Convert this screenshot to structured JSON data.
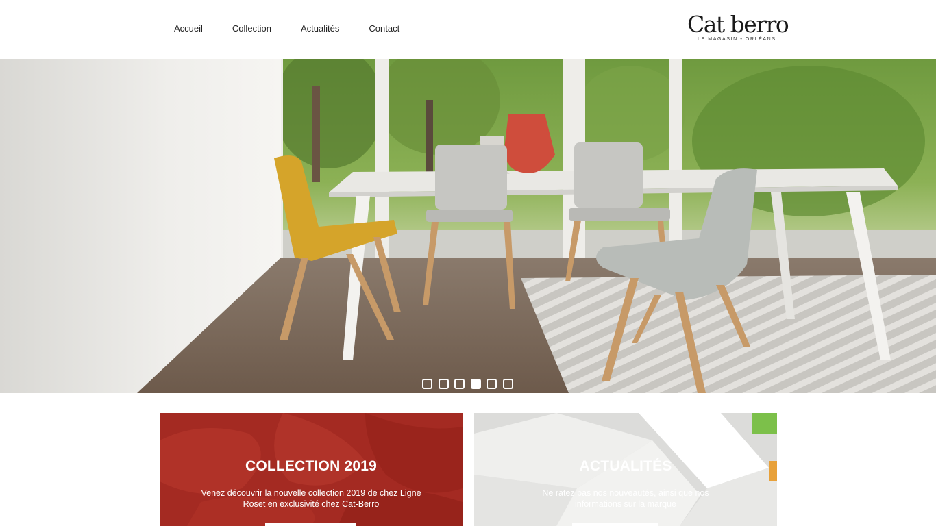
{
  "header": {
    "nav": [
      "Accueil",
      "Collection",
      "Actualités",
      "Contact"
    ],
    "logo": {
      "main": "Cat berro",
      "sub": "LE MAGASIN • ORLÉANS"
    }
  },
  "hero": {
    "slides_count": 6,
    "active_slide": 4
  },
  "cards": [
    {
      "title": "COLLECTION 2019",
      "text": "Venez découvrir la nouvelle collection 2019 de chez Ligne Roset en exclusivité chez Cat-Berro",
      "color": "#a42a22"
    },
    {
      "title": "ACTUALITÉS",
      "text": "Ne ratez pas nos nouveautés, ainsi que nos informations sur la marque",
      "color": "#e6e6e4"
    }
  ]
}
